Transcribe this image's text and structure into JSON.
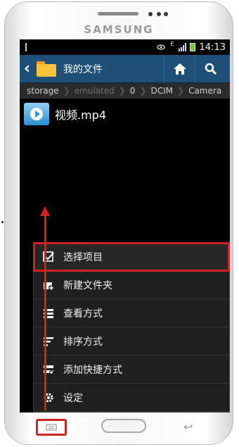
{
  "device": {
    "brand": "SAMSUNG"
  },
  "status_bar": {
    "time": "14:13",
    "network": "E"
  },
  "action_bar": {
    "title": "我的文件"
  },
  "breadcrumb": [
    "storage",
    "emulated",
    "0",
    "DCIM",
    "Camera"
  ],
  "files": [
    {
      "name": "视频.mp4"
    }
  ],
  "menu": {
    "items": [
      {
        "label": "选择项目",
        "icon": "checkbox-icon"
      },
      {
        "label": "新建文件夹",
        "icon": "new-folder-icon"
      },
      {
        "label": "查看方式",
        "icon": "view-mode-icon"
      },
      {
        "label": "排序方式",
        "icon": "sort-icon"
      },
      {
        "label": "添加快捷方式",
        "icon": "shortcut-icon"
      },
      {
        "label": "设定",
        "icon": "gear-icon"
      }
    ]
  },
  "colors": {
    "action_bar": "#1e4f77",
    "highlight": "#d32020"
  }
}
